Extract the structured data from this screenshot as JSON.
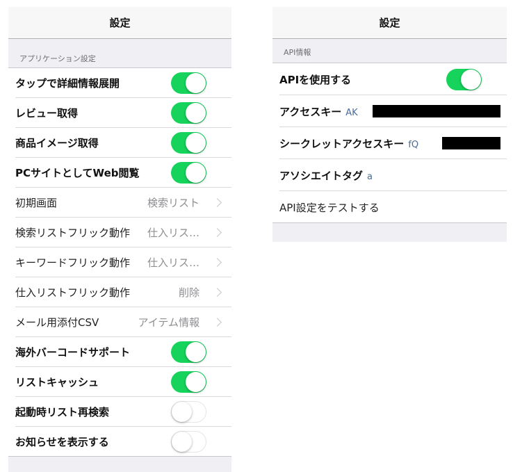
{
  "left": {
    "title": "設定",
    "section": "アプリケーション設定",
    "rows": [
      {
        "label": "タップで詳細情報展開",
        "type": "toggle",
        "on": true
      },
      {
        "label": "レビュー取得",
        "type": "toggle",
        "on": true
      },
      {
        "label": "商品イメージ取得",
        "type": "toggle",
        "on": true
      },
      {
        "label": "PCサイトとしてWeb閲覧",
        "type": "toggle",
        "on": true
      },
      {
        "label": "初期画面",
        "type": "nav",
        "value": "検索リスト"
      },
      {
        "label": "検索リストフリック動作",
        "type": "nav",
        "value": "仕入リス…"
      },
      {
        "label": "キーワードフリック動作",
        "type": "nav",
        "value": "仕入リス…"
      },
      {
        "label": "仕入リストフリック動作",
        "type": "nav",
        "value": "削除"
      },
      {
        "label": "メール用添付CSV",
        "type": "nav",
        "value": "アイテム情報"
      },
      {
        "label": "海外バーコードサポート",
        "type": "toggle",
        "on": true
      },
      {
        "label": "リストキャッシュ",
        "type": "toggle",
        "on": true
      },
      {
        "label": "起動時リスト再検索",
        "type": "toggle",
        "on": false
      },
      {
        "label": "お知らせを表示する",
        "type": "toggle",
        "on": false
      }
    ]
  },
  "right": {
    "title": "設定",
    "section": "API情報",
    "use_api": {
      "label": "APIを使用する",
      "on": true
    },
    "access_key": {
      "label": "アクセスキー",
      "value": "AK"
    },
    "secret_key": {
      "label": "シークレットアクセスキー",
      "value": "fQ"
    },
    "associate_tag": {
      "label": "アソシエイトタグ",
      "value": "a"
    },
    "test": {
      "label": "API設定をテストする"
    }
  },
  "colors": {
    "toggle_on": "#16d35c",
    "value_text": "#8e8e93",
    "sub_text": "#4a6b9a"
  }
}
